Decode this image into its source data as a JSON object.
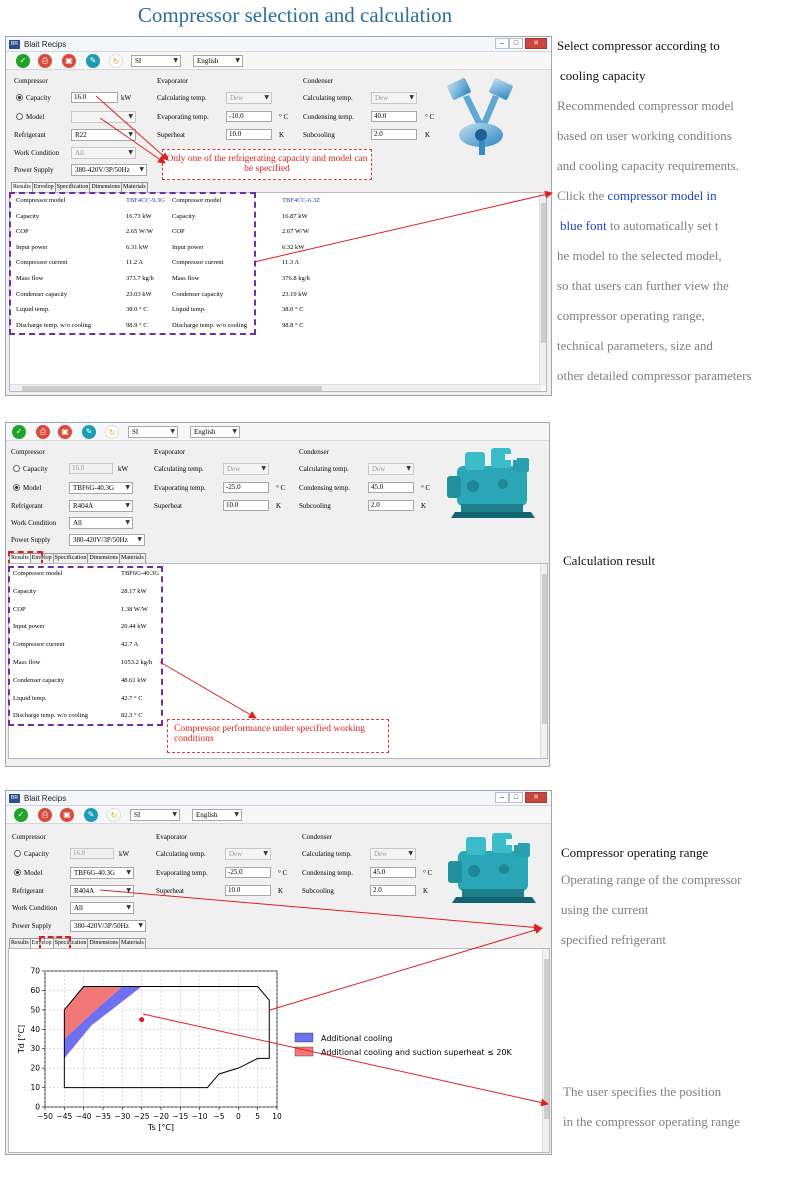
{
  "title": "Compressor selection and calculation",
  "windows": [
    {
      "title": "Blait Recips",
      "unit": "SI",
      "language": "English",
      "compressor_section": "Compressor",
      "evaporator_section": "Evaporator",
      "condenser_section": "Condenser",
      "capacity_label": "Capacity",
      "capacity_value": "16.0",
      "capacity_unit": "kW",
      "model_label": "Model",
      "model_value": "",
      "refrigerant_label": "Refrigerant",
      "refrigerant_value": "R22",
      "work_condition_label": "Work Condition",
      "work_condition_value": "All",
      "power_supply_label": "Power Supply",
      "power_supply_value": "380-420V/3P/50Hz",
      "calc_temp_label": "Calculating temp.",
      "evap_calc_temp_value": "Dew",
      "cond_calc_temp_value": "Dew",
      "evap_temp_label": "Evaporating temp.",
      "evap_temp_value": "-10.0",
      "temp_unit": "° C",
      "cond_temp_label": "Condensing temp.",
      "cond_temp_value": "40.0",
      "superheat_label": "Superheat",
      "superheat_value": "10.0",
      "subcooling_label": "Subcooling",
      "subcooling_value": "2.0",
      "k_unit": "K",
      "tabs": [
        "Results",
        "Envelop",
        "Specification",
        "Dimensions",
        "Materials"
      ],
      "results": [
        {
          "label": "Compressor model",
          "v1": "TBF4CC-9.3G",
          "v2": "TBF4CC-6.3Z"
        },
        {
          "label": "Capacity",
          "v1": "16.73 kW",
          "v2": "16.87 kW"
        },
        {
          "label": "COP",
          "v1": "2.65 W/W",
          "v2": "2.67 W/W"
        },
        {
          "label": "Input power",
          "v1": "6.31 kW",
          "v2": "6.32 kW"
        },
        {
          "label": "Compressor current",
          "v1": "11.2 A",
          "v2": "11.3 A"
        },
        {
          "label": "Mass flow",
          "v1": "373.7 kg/h",
          "v2": "376.8 kg/h"
        },
        {
          "label": "Condenser capacity",
          "v1": "23.03 kW",
          "v2": "23.19 kW"
        },
        {
          "label": "Liquid temp.",
          "v1": "38.0 ° C",
          "v2": "38.0 ° C"
        },
        {
          "label": "Discharge temp. w/o cooling",
          "v1": "98.9 ° C",
          "v2": "98.8 ° C"
        }
      ],
      "callout": "Only one of the refrigerating capacity and model can be specified"
    },
    {
      "title": "",
      "unit": "SI",
      "language": "English",
      "compressor_section": "Compressor",
      "evaporator_section": "Evaporator",
      "condenser_section": "Condenser",
      "capacity_label": "Capacity",
      "capacity_value": "16.0",
      "capacity_unit": "kW",
      "model_label": "Model",
      "model_value": "TBF6G-40.3G",
      "refrigerant_label": "Refrigerant",
      "refrigerant_value": "R404A",
      "work_condition_label": "Work Condition",
      "work_condition_value": "All",
      "power_supply_label": "Power Supply",
      "power_supply_value": "380-420V/3P/50Hz",
      "calc_temp_label": "Calculating temp.",
      "evap_calc_temp_value": "Dew",
      "cond_calc_temp_value": "Dew",
      "evap_temp_label": "Evaporating temp.",
      "evap_temp_value": "-25.0",
      "temp_unit": "° C",
      "cond_temp_label": "Condensing temp.",
      "cond_temp_value": "45.0",
      "superheat_label": "Superheat",
      "superheat_value": "10.0",
      "subcooling_label": "Subcooling",
      "subcooling_value": "2.0",
      "k_unit": "K",
      "tabs": [
        "Results",
        "Envelop",
        "Specification",
        "Dimensions",
        "Materials"
      ],
      "results": [
        {
          "label": "Compressor model",
          "v1": "TBF6G-40.3G"
        },
        {
          "label": "Capacity",
          "v1": "28.17 kW"
        },
        {
          "label": "COP",
          "v1": "1.38 W/W"
        },
        {
          "label": "Input power",
          "v1": "20.44 kW"
        },
        {
          "label": "Compressor current",
          "v1": "42.7 A"
        },
        {
          "label": "Mass flow",
          "v1": "1053.2 kg/h"
        },
        {
          "label": "Condenser capacity",
          "v1": "48.61 kW"
        },
        {
          "label": "Liquid temp.",
          "v1": "42.7 ° C"
        },
        {
          "label": "Discharge temp. w/o cooling",
          "v1": "82.3 ° C"
        }
      ],
      "callout": "Compressor performance under specified working conditions"
    },
    {
      "title": "Blait Recips",
      "unit": "SI",
      "language": "English",
      "compressor_section": "Compressor",
      "evaporator_section": "Evaporator",
      "condenser_section": "Condenser",
      "capacity_label": "Capacity",
      "capacity_value": "16.0",
      "capacity_unit": "kW",
      "model_label": "Model",
      "model_value": "TBF6G-40.3G",
      "refrigerant_label": "Refrigerant",
      "refrigerant_value": "R404A",
      "work_condition_label": "Work Condition",
      "work_condition_value": "All",
      "power_supply_label": "Power Supply",
      "power_supply_value": "380-420V/3P/50Hz",
      "calc_temp_label": "Calculating temp.",
      "evap_calc_temp_value": "Dew",
      "cond_calc_temp_value": "Dew",
      "evap_temp_label": "Evaporating temp.",
      "evap_temp_value": "-25.0",
      "temp_unit": "° C",
      "cond_temp_label": "Condensing temp.",
      "cond_temp_value": "45.0",
      "superheat_label": "Superheat",
      "superheat_value": "10.0",
      "subcooling_label": "Subcooling",
      "subcooling_value": "2.0",
      "k_unit": "K",
      "tabs": [
        "Results",
        "Envelop",
        "Specification",
        "Dimensions",
        "Materials"
      ]
    }
  ],
  "side_notes": {
    "s1": {
      "head1": "Select compressor according to",
      "head2": "cooling capacity",
      "lines": [
        "Recommended compressor model",
        "based on user working conditions",
        "and cooling capacity requirements."
      ],
      "click_pre": "Click the ",
      "click_blue": "compressor model in",
      "blue_font": "blue font",
      "after_blue": " to automatically set t",
      "rest": [
        "he model to the selected model,",
        "so that users can further view the",
        "compressor operating range,",
        "technical parameters, size and",
        "other detailed compressor parameters"
      ]
    },
    "s2": {
      "head": "Calculation result"
    },
    "s3": {
      "head": "Compressor operating range",
      "lines": [
        "Operating range of the compressor",
        "using the current",
        "specified refrigerant"
      ],
      "lines2": [
        "The user specifies the position",
        "in the compressor operating range"
      ]
    }
  },
  "chart_data": {
    "type": "area",
    "xlabel": "Ts [°C]",
    "ylabel": "Td [°C]",
    "xlim": [
      -50,
      10
    ],
    "ylim": [
      0,
      70
    ],
    "xticks": [
      -50,
      -45,
      -40,
      -35,
      -30,
      -25,
      -20,
      -15,
      -10,
      -5,
      0,
      5,
      10
    ],
    "yticks": [
      0,
      10,
      20,
      30,
      40,
      50,
      60,
      70
    ],
    "envelope": [
      [
        -45,
        10
      ],
      [
        -45,
        50
      ],
      [
        -40,
        62
      ],
      [
        5,
        62
      ],
      [
        8,
        55
      ],
      [
        8,
        25
      ],
      [
        5,
        25
      ],
      [
        0,
        20
      ],
      [
        -5,
        17
      ],
      [
        -8,
        10
      ],
      [
        -45,
        10
      ]
    ],
    "series": [
      {
        "name": "Additional cooling",
        "color": "#6f6ff2",
        "polygon": [
          [
            -45,
            25
          ],
          [
            -45,
            35
          ],
          [
            -38,
            48
          ],
          [
            -30,
            62
          ],
          [
            -25,
            62
          ],
          [
            -38,
            42
          ]
        ]
      },
      {
        "name": "Additional cooling and suction superheat ≤ 20K",
        "color": "#f27878",
        "polygon": [
          [
            -45,
            35
          ],
          [
            -45,
            50
          ],
          [
            -40,
            62
          ],
          [
            -30,
            62
          ],
          [
            -38,
            48
          ]
        ]
      }
    ],
    "user_point": [
      -25,
      45
    ],
    "grid": true,
    "legend": "right"
  }
}
